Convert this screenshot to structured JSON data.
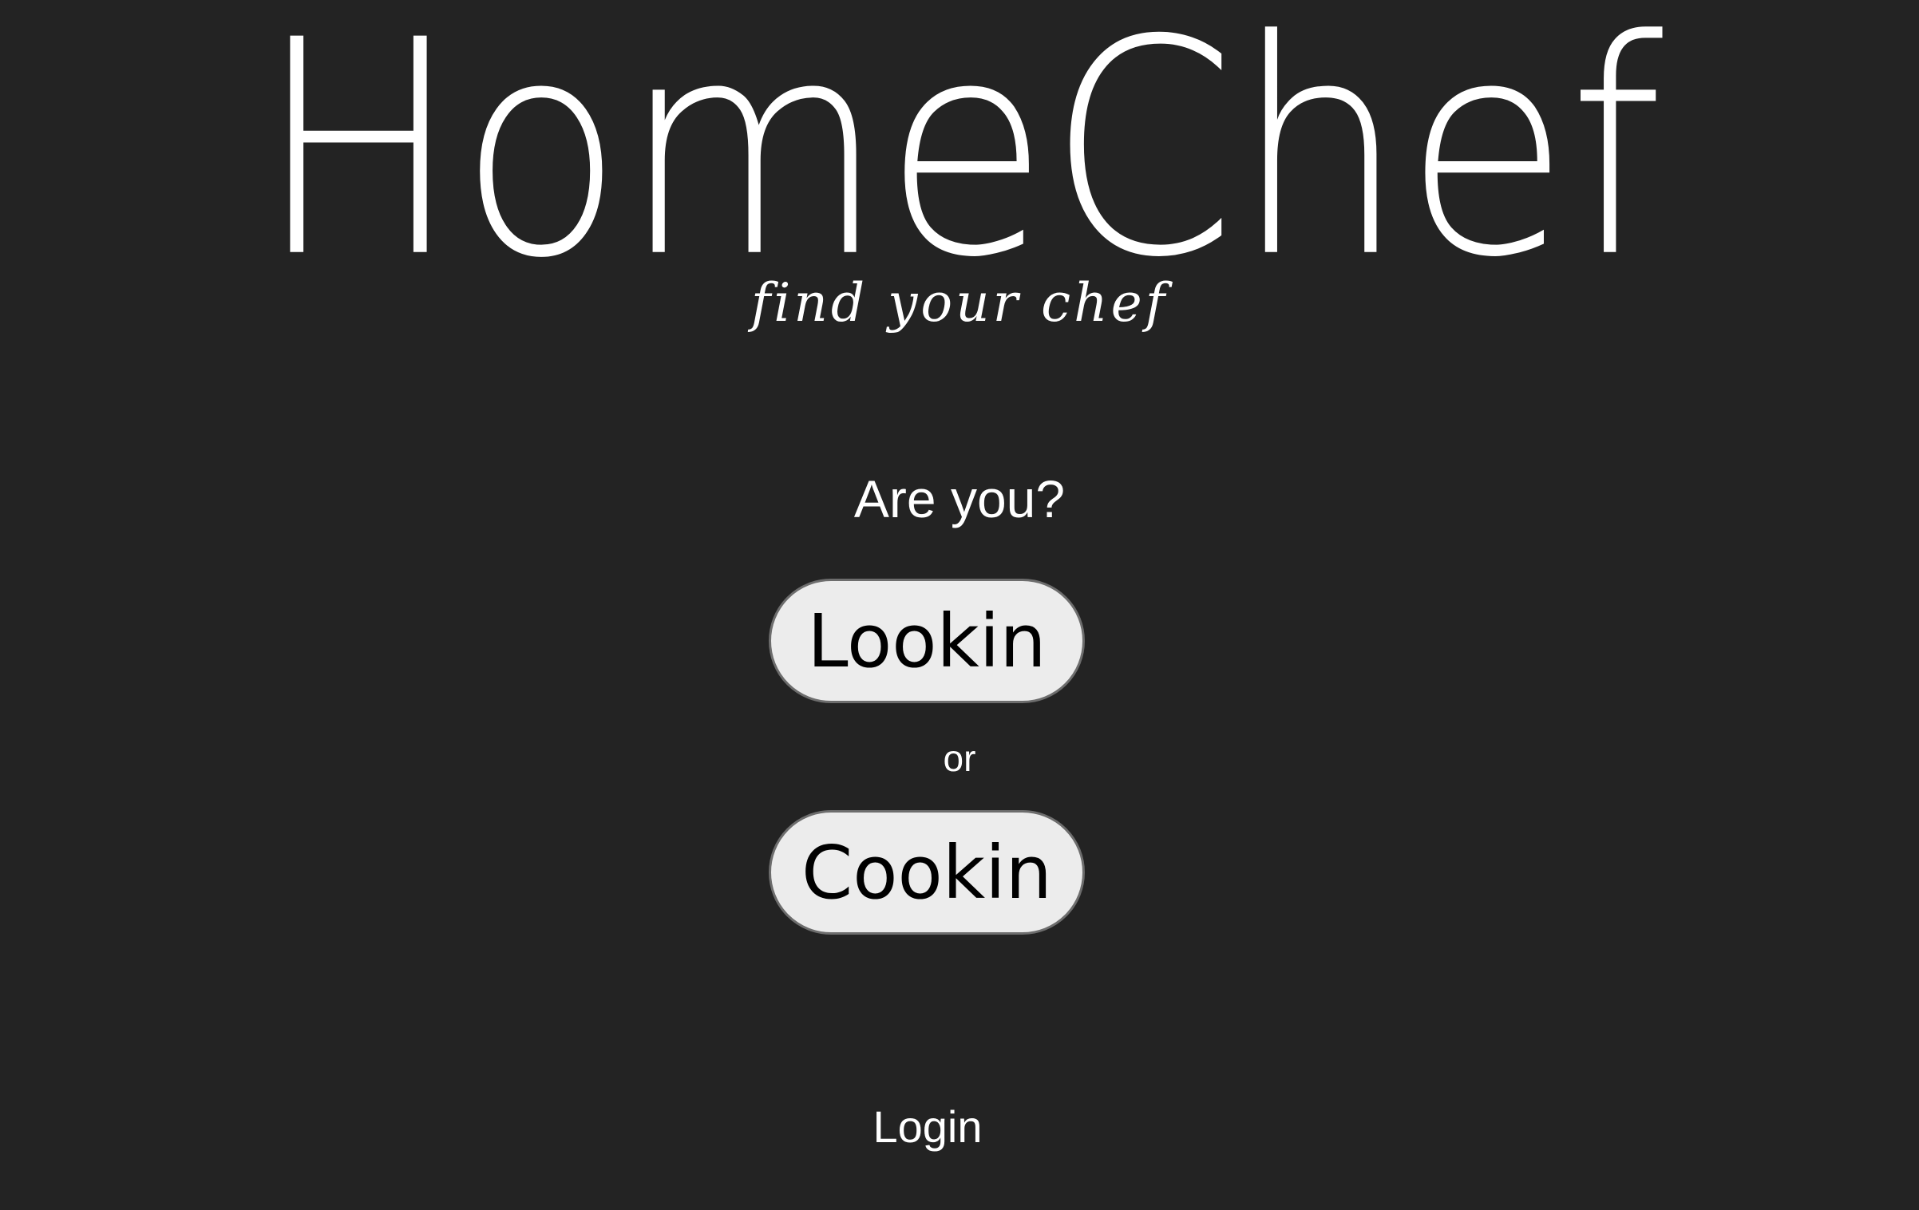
{
  "brand": {
    "title": "HomeChef",
    "tagline": "find your chef"
  },
  "main": {
    "prompt": "Are you?",
    "option_lookin": "Lookin",
    "separator": "or",
    "option_cookin": "Cookin"
  },
  "footer": {
    "login": "Login"
  },
  "colors": {
    "background": "#232323",
    "text": "#ffffff",
    "button_background": "#ececec",
    "button_text": "#000000"
  }
}
